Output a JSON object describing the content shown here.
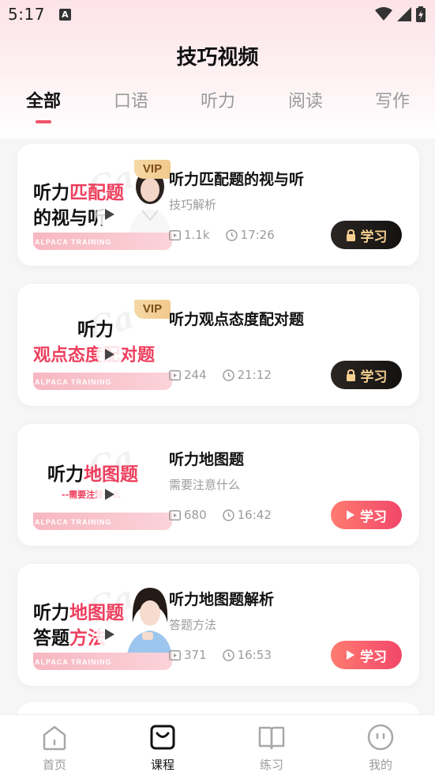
{
  "status_bar": {
    "time": "5:17",
    "notification_icon": "a-box-icon",
    "icons": [
      "wifi-icon",
      "signal-icon",
      "battery-charging-icon"
    ]
  },
  "page": {
    "title": "技巧视频"
  },
  "tabs": [
    {
      "label": "全部",
      "active": true
    },
    {
      "label": "口语",
      "active": false
    },
    {
      "label": "听力",
      "active": false
    },
    {
      "label": "阅读",
      "active": false
    },
    {
      "label": "写作",
      "active": false
    }
  ],
  "colors": {
    "accent": "#f0566b",
    "vip_gold": "#f2c98c",
    "locked_button": "#1c1a18",
    "study_button": "#f2466a"
  },
  "thumb_brand": "ALPACA TRAINING",
  "videos": [
    {
      "title": "听力匹配题的视与听",
      "subtitle": "技巧解析",
      "views": "1.1k",
      "duration": "17:26",
      "vip": true,
      "vip_label": "VIP",
      "button_label": "学习",
      "locked": true,
      "thumb_line1_black": "听力",
      "thumb_line1_pink": "匹配题",
      "thumb_line2": "的视与听",
      "thumb_sub": ""
    },
    {
      "title": "听力观点态度配对题",
      "subtitle": "",
      "views": "244",
      "duration": "21:12",
      "vip": true,
      "vip_label": "VIP",
      "button_label": "学习",
      "locked": true,
      "thumb_line1_black": "听力",
      "thumb_line1_pink": "",
      "thumb_line2": "观点态度配对题",
      "thumb_sub": ""
    },
    {
      "title": "听力地图题",
      "subtitle": "需要注意什么",
      "views": "680",
      "duration": "16:42",
      "vip": false,
      "vip_label": "",
      "button_label": "学习",
      "locked": false,
      "thumb_line1_black": "听力",
      "thumb_line1_pink": "地图题",
      "thumb_line2": "",
      "thumb_sub": "--需要注意什么"
    },
    {
      "title": "听力地图题解析",
      "subtitle": "答题方法",
      "views": "371",
      "duration": "16:53",
      "vip": false,
      "vip_label": "",
      "button_label": "学习",
      "locked": false,
      "thumb_line1_black": "听力",
      "thumb_line1_pink": "地图题",
      "thumb_line2_black": "答题",
      "thumb_line2_pink": "方法",
      "thumb_sub": ""
    }
  ],
  "bottom_nav": [
    {
      "label": "首页",
      "icon": "home-icon",
      "active": false
    },
    {
      "label": "课程",
      "icon": "course-bag-icon",
      "active": true
    },
    {
      "label": "练习",
      "icon": "book-icon",
      "active": false
    },
    {
      "label": "我的",
      "icon": "profile-face-icon",
      "active": false
    }
  ]
}
